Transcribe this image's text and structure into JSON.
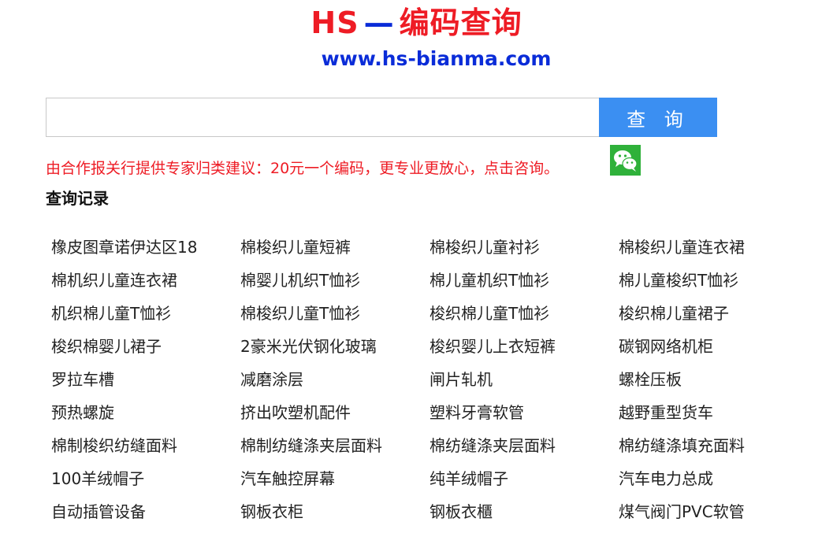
{
  "header": {
    "brand_hs": "HS",
    "brand_dash": "—",
    "brand_cn": "编码查询",
    "site_url": "www.hs-bianma.com"
  },
  "search": {
    "value": "",
    "placeholder": "",
    "button_label": "查 询"
  },
  "notice": {
    "text": "由合作报关行提供专家归类建议：20元一个编码，更专业更放心，点击咨询。",
    "icon": "wechat-icon",
    "icon_color": "#2fb13a"
  },
  "history": {
    "title": "查询记录",
    "items": [
      "橡皮图章诺伊达区18",
      "棉梭织儿童短裤",
      "棉梭织儿童衬衫",
      "棉梭织儿童连衣裙",
      "棉机织儿童连衣裙",
      "棉婴儿机织T恤衫",
      "棉儿童机织T恤衫",
      "棉儿童梭织T恤衫",
      "机织棉儿童T恤衫",
      "棉梭织儿童T恤衫",
      "梭织棉儿童T恤衫",
      "梭织棉儿童裙子",
      "梭织棉婴儿裙子",
      "2豪米光伏钢化玻璃",
      "梭织婴儿上衣短裤",
      "碳钢网络机柜",
      "罗拉车槽",
      "减磨涂层",
      "闸片轧机",
      "螺栓压板",
      "预热螺旋",
      "挤出吹塑机配件",
      "塑料牙膏软管",
      "越野重型货车",
      "棉制梭织纺缝面料",
      "棉制纺缝涤夹层面料",
      "棉纺缝涤夹层面料",
      "棉纺缝涤填充面料",
      "100羊绒帽子",
      "汽车触控屏幕",
      "纯羊绒帽子",
      "汽车电力总成",
      "自动插管设备",
      "钢板衣柜",
      "钢板衣櫃",
      "煤气阀门PVC软管"
    ]
  },
  "colors": {
    "brand_red": "#ee1c25",
    "brand_blue": "#0a2cd8",
    "button_blue": "#3b8ff2"
  }
}
